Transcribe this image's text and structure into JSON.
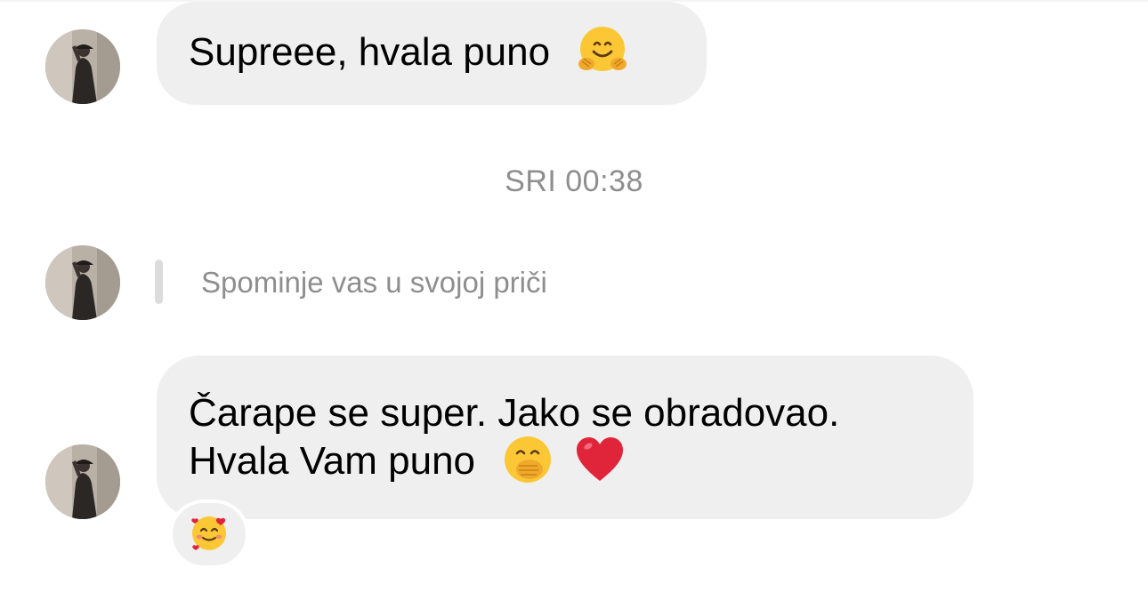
{
  "messages": [
    {
      "text": "Supreee, hvala puno",
      "emoji": "hugging-face"
    },
    {
      "line1": "Čarape se super. Jako se obradovao.",
      "line2": "Hvala Vam puno",
      "emojis": [
        "face-with-hand-over-mouth",
        "red-heart"
      ],
      "reaction": "smiling-face-with-hearts"
    }
  ],
  "timestamp": "SRI 00:38",
  "story_mention": "Spominje vas u svojoj priči",
  "colors": {
    "bubble": "#efefef",
    "secondary_text": "#8e8e8e",
    "heart": "#e0243a",
    "emoji_yellow": "#fbc735"
  }
}
